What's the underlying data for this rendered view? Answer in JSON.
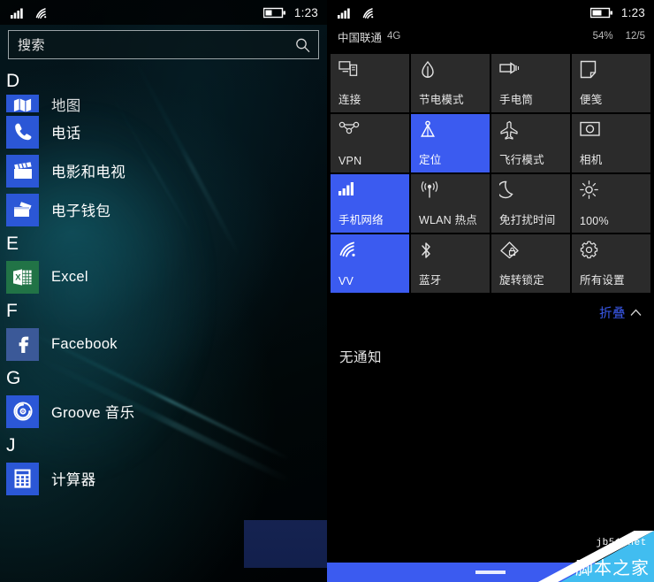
{
  "left_panel": {
    "status_bar": {
      "signal_icon": "cellular-signal-icon",
      "wifi_icon": "wifi-icon",
      "battery_icon": "battery-icon",
      "time": "1:23"
    },
    "search": {
      "placeholder": "搜索",
      "value": "",
      "icon": "search-icon"
    },
    "groups": [
      {
        "letter": "D",
        "apps": [
          {
            "name": "地图",
            "icon": "maps-icon",
            "tile_color": "#2b57d6",
            "clipped": true
          },
          {
            "name": "电话",
            "icon": "phone-icon",
            "tile_color": "#2b57d6",
            "clipped": false
          },
          {
            "name": "电影和电视",
            "icon": "movies-tv-icon",
            "tile_color": "#2b57d6",
            "clipped": false
          },
          {
            "name": "电子钱包",
            "icon": "wallet-icon",
            "tile_color": "#2b57d6",
            "clipped": false
          }
        ]
      },
      {
        "letter": "E",
        "apps": [
          {
            "name": "Excel",
            "icon": "excel-icon",
            "tile_color": "#217346",
            "clipped": false
          }
        ]
      },
      {
        "letter": "F",
        "apps": [
          {
            "name": "Facebook",
            "icon": "facebook-icon",
            "tile_color": "#3b5998",
            "clipped": false
          }
        ]
      },
      {
        "letter": "G",
        "apps": [
          {
            "name": "Groove 音乐",
            "icon": "groove-music-icon",
            "tile_color": "#2b57d6",
            "clipped": false
          }
        ]
      },
      {
        "letter": "J",
        "apps": [
          {
            "name": "计算器",
            "icon": "calculator-icon",
            "tile_color": "#2b57d6",
            "clipped": false
          }
        ]
      }
    ]
  },
  "right_panel": {
    "status_bar": {
      "signal_icon": "cellular-signal-icon",
      "wifi_icon": "wifi-icon",
      "battery_icon": "battery-icon",
      "time": "1:23"
    },
    "carrier_row": {
      "carrier": "中国联通",
      "network_type": "4G",
      "battery_percent": "54%",
      "date": "12/5"
    },
    "quick_actions": [
      {
        "label": "连接",
        "icon": "connect-icon",
        "active": false
      },
      {
        "label": "节电模式",
        "icon": "battery-saver-icon",
        "active": false
      },
      {
        "label": "手电筒",
        "icon": "flashlight-icon",
        "active": false
      },
      {
        "label": "便笺",
        "icon": "note-icon",
        "active": false
      },
      {
        "label": "VPN",
        "icon": "vpn-icon",
        "active": false
      },
      {
        "label": "定位",
        "icon": "location-icon",
        "active": true
      },
      {
        "label": "飞行模式",
        "icon": "airplane-icon",
        "active": false
      },
      {
        "label": "相机",
        "icon": "camera-icon",
        "active": false
      },
      {
        "label": "手机网络",
        "icon": "cellular-signal-icon",
        "active": true
      },
      {
        "label": "WLAN 热点",
        "icon": "hotspot-icon",
        "active": false
      },
      {
        "label": "免打扰时间",
        "icon": "quiet-hours-moon-icon",
        "active": false
      },
      {
        "label": "100%",
        "icon": "brightness-sun-icon",
        "active": false
      },
      {
        "label": "VV",
        "icon": "wifi-icon",
        "active": true
      },
      {
        "label": "蓝牙",
        "icon": "bluetooth-icon",
        "active": false
      },
      {
        "label": "旋转锁定",
        "icon": "rotation-lock-icon",
        "active": false
      },
      {
        "label": "所有设置",
        "icon": "gear-icon",
        "active": false
      }
    ],
    "collapse": {
      "label": "折叠",
      "chevron": "∧",
      "icon": "chevron-up-icon"
    },
    "notifications": {
      "empty_text": "无通知"
    },
    "navbar": {
      "handle_icon": "nav-handle-icon"
    }
  },
  "watermark": {
    "url": "jb51.net",
    "site_name": "脚本之家",
    "band_color": "#41bdf0"
  },
  "colors": {
    "tile_active": "#3b5bf0",
    "tile_inactive": "#2b2b2b",
    "accent_link": "#3b5bf0",
    "app_tile_blue": "#2b57d6",
    "excel_green": "#217346",
    "facebook_blue": "#3b5998"
  }
}
